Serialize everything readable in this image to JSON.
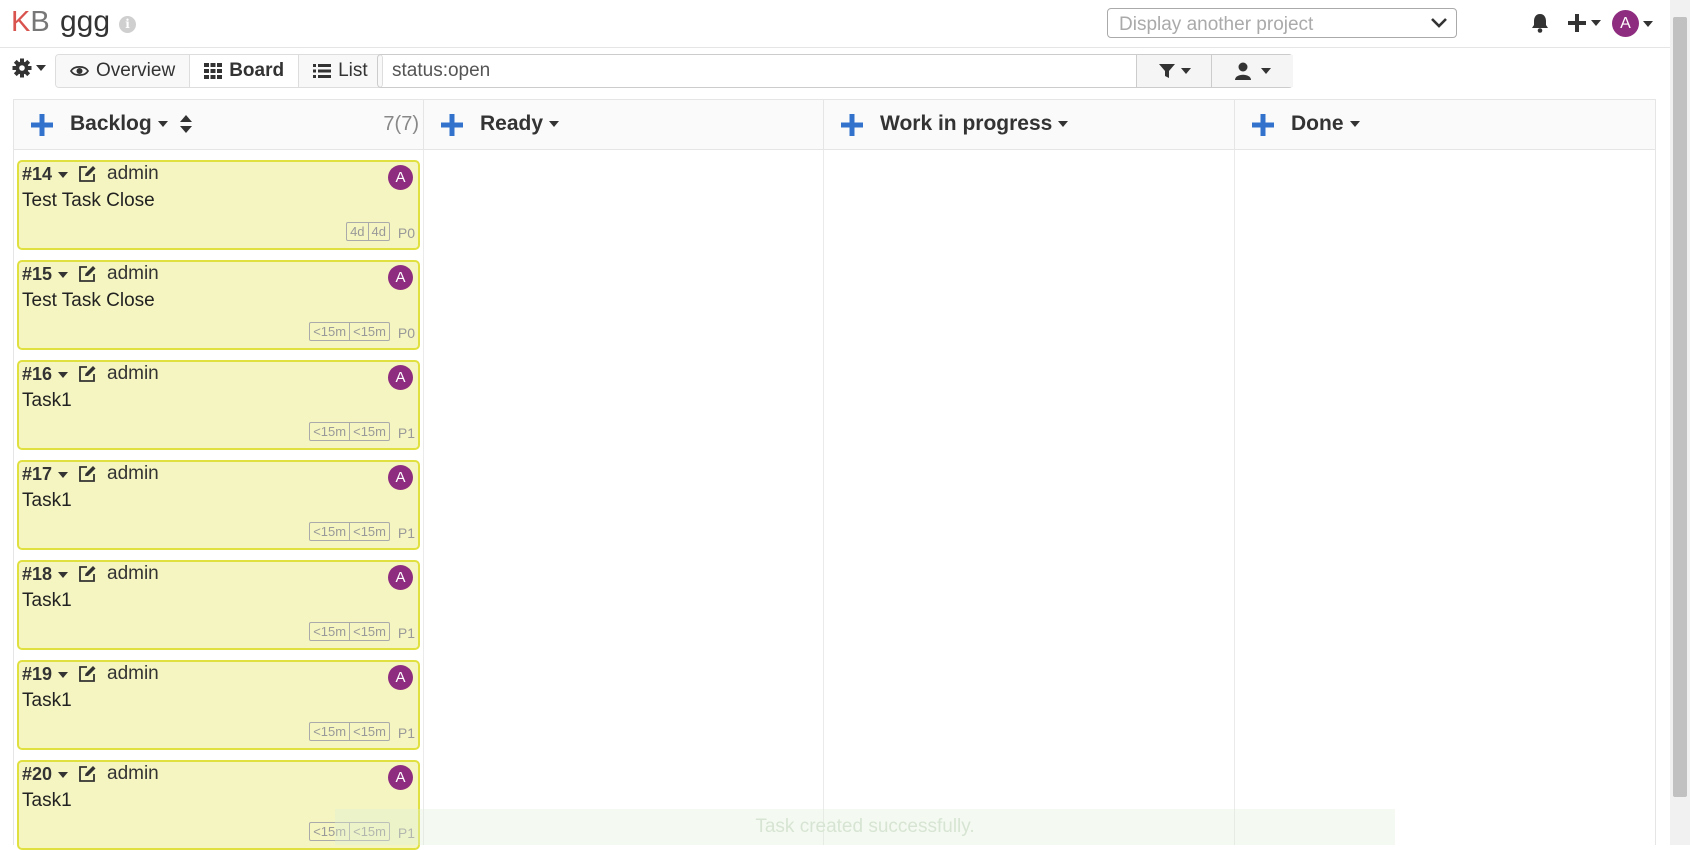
{
  "header": {
    "logo_k": "K",
    "logo_b": "B",
    "project_title": "ggg",
    "project_select_placeholder": "Display another project",
    "user_initial": "A"
  },
  "toolbar": {
    "views": [
      {
        "label": "Overview",
        "icon": "eye-icon"
      },
      {
        "label": "Board",
        "icon": "th-icon",
        "active": true
      },
      {
        "label": "List",
        "icon": "list-icon"
      }
    ],
    "search_value": "status:open"
  },
  "columns": [
    {
      "title": "Backlog",
      "count": "7(7)"
    },
    {
      "title": "Ready",
      "count": ""
    },
    {
      "title": "Work in progress",
      "count": ""
    },
    {
      "title": "Done",
      "count": ""
    }
  ],
  "cards": [
    {
      "id": "#14",
      "assignee": "admin",
      "title": "Test Task Close",
      "time_estimated": "4d",
      "time_spent": "4d",
      "priority": "P0",
      "avatar": "A"
    },
    {
      "id": "#15",
      "assignee": "admin",
      "title": "Test Task Close",
      "time_estimated": "<15m",
      "time_spent": "<15m",
      "priority": "P0",
      "avatar": "A"
    },
    {
      "id": "#16",
      "assignee": "admin",
      "title": "Task1",
      "time_estimated": "<15m",
      "time_spent": "<15m",
      "priority": "P1",
      "avatar": "A"
    },
    {
      "id": "#17",
      "assignee": "admin",
      "title": "Task1",
      "time_estimated": "<15m",
      "time_spent": "<15m",
      "priority": "P1",
      "avatar": "A"
    },
    {
      "id": "#18",
      "assignee": "admin",
      "title": "Task1",
      "time_estimated": "<15m",
      "time_spent": "<15m",
      "priority": "P1",
      "avatar": "A"
    },
    {
      "id": "#19",
      "assignee": "admin",
      "title": "Task1",
      "time_estimated": "<15m",
      "time_spent": "<15m",
      "priority": "P1",
      "avatar": "A"
    },
    {
      "id": "#20",
      "assignee": "admin",
      "title": "Task1",
      "time_estimated": "<15m",
      "time_spent": "<15m",
      "priority": "P1",
      "avatar": "A"
    }
  ],
  "toast": "Task created successfully.",
  "colors": {
    "accent": "#3372cc",
    "avatar": "#8e2d7f",
    "card_bg": "#f5f5c1",
    "card_border": "#e0e040",
    "logo_k": "#d9534f"
  }
}
